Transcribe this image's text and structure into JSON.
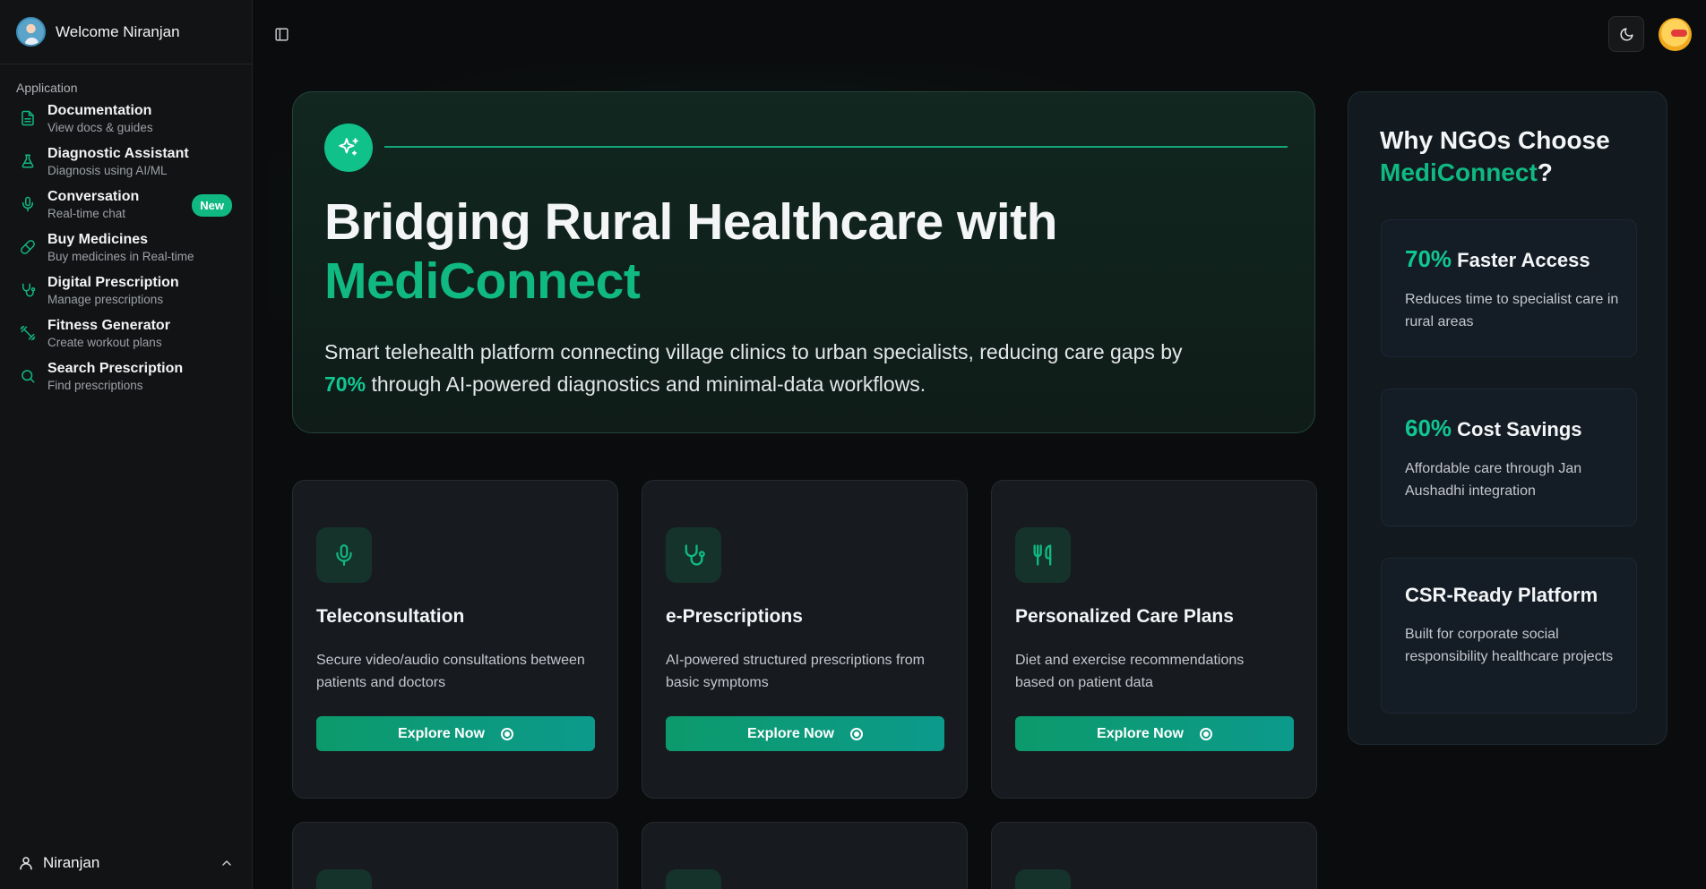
{
  "sidebar": {
    "welcome": "Welcome Niranjan",
    "group_label": "Application",
    "items": [
      {
        "title": "Documentation",
        "subtitle": "View docs & guides",
        "icon": "file-text-icon"
      },
      {
        "title": "Diagnostic Assistant",
        "subtitle": "Diagnosis using AI/ML",
        "icon": "flask-icon"
      },
      {
        "title": "Conversation",
        "subtitle": "Real-time chat",
        "icon": "mic-icon",
        "badge": "New"
      },
      {
        "title": "Buy Medicines",
        "subtitle": "Buy medicines in Real-time",
        "icon": "pill-icon"
      },
      {
        "title": "Digital Prescription",
        "subtitle": "Manage prescriptions",
        "icon": "stethoscope-icon"
      },
      {
        "title": "Fitness Generator",
        "subtitle": "Create workout plans",
        "icon": "dumbbell-icon"
      },
      {
        "title": "Search Prescription",
        "subtitle": "Find prescriptions",
        "icon": "search-icon"
      }
    ],
    "footer_user": "Niranjan"
  },
  "hero": {
    "title_line1": "Bridging Rural Healthcare with",
    "title_brand": "MediConnect",
    "desc_part1": "Smart telehealth platform connecting village clinics to urban specialists, reducing care gaps by",
    "desc_highlight": "70%",
    "desc_part2": "through AI-powered diagnostics and minimal-data workflows."
  },
  "features": [
    {
      "title": "Teleconsultation",
      "desc": "Secure video/audio consultations between patients and doctors",
      "button": "Explore Now",
      "icon": "mic-icon"
    },
    {
      "title": "e-Prescriptions",
      "desc": "AI-powered structured prescriptions from basic symptoms",
      "button": "Explore Now",
      "icon": "stethoscope-icon"
    },
    {
      "title": "Personalized Care Plans",
      "desc": "Diet and exercise recommendations based on patient data",
      "button": "Explore Now",
      "icon": "utensils-icon"
    }
  ],
  "why": {
    "title_part1": "Why NGOs Choose",
    "title_brand": "MediConnect",
    "title_end": "?",
    "cards": [
      {
        "stat": "70%",
        "title": "Faster Access",
        "desc": "Reduces time to specialist care in rural areas"
      },
      {
        "stat": "60%",
        "title": "Cost Savings",
        "desc": "Affordable care through Jan Aushadhi integration"
      },
      {
        "stat": "",
        "title": "CSR-Ready Platform",
        "desc": "Built for corporate social responsibility healthcare projects"
      }
    ]
  },
  "colors": {
    "accent": "#10b981",
    "background": "#0b0c0d",
    "sidebar": "#121315",
    "card": "#171a1f"
  }
}
